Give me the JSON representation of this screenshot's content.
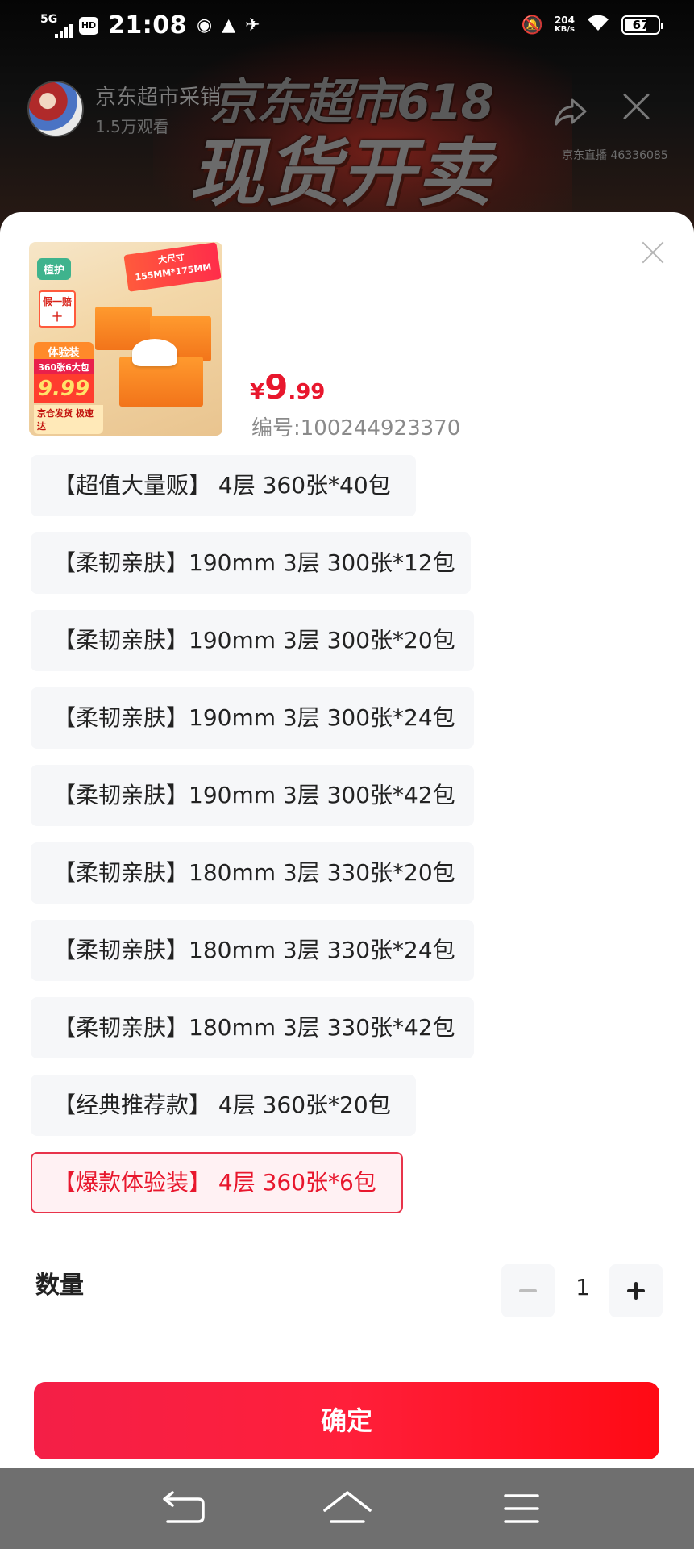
{
  "status_bar": {
    "network": "5G",
    "hd": "HD",
    "time": "21:08",
    "speed_value": "204",
    "speed_unit": "KB/s",
    "battery": "67",
    "battery_level": 0.67
  },
  "live": {
    "anchor_name": "京东超市采销",
    "views": "1.5万观看",
    "banner_line1": "京东超市618",
    "banner_line2": "现货开卖",
    "room_id": "京东直播 46336085"
  },
  "product": {
    "image_texts": {
      "brand": "植护",
      "size_title": "大尺寸",
      "size_value": "155MM*175MM",
      "guarantee": "假一赔十",
      "trial": "体验装",
      "pack": "360张6大包",
      "price": "9.99",
      "ship": "京仓发货 极速达"
    },
    "price_currency": "¥",
    "price_integer": "9",
    "price_decimal": ".99",
    "sku_code": "编号:100244923370"
  },
  "specs": [
    {
      "label": "【超值大量贩】 4层 360张*40包",
      "selected": false
    },
    {
      "label": "【柔韧亲肤】190mm 3层 300张*12包",
      "selected": false
    },
    {
      "label": "【柔韧亲肤】190mm 3层 300张*20包",
      "selected": false
    },
    {
      "label": "【柔韧亲肤】190mm 3层 300张*24包",
      "selected": false
    },
    {
      "label": "【柔韧亲肤】190mm 3层 300张*42包",
      "selected": false
    },
    {
      "label": "【柔韧亲肤】180mm 3层 330张*20包",
      "selected": false
    },
    {
      "label": "【柔韧亲肤】180mm 3层 330张*24包",
      "selected": false
    },
    {
      "label": "【柔韧亲肤】180mm 3层 330张*42包",
      "selected": false
    },
    {
      "label": "【经典推荐款】 4层 360张*20包",
      "selected": false
    },
    {
      "label": "【爆款体验装】 4层 360张*6包",
      "selected": true
    }
  ],
  "quantity": {
    "label": "数量",
    "value": "1"
  },
  "confirm_label": "确定",
  "colors": {
    "accent_red": "#e8172d",
    "selected_bg": "#fff1f3",
    "option_bg": "#f6f7f9"
  }
}
